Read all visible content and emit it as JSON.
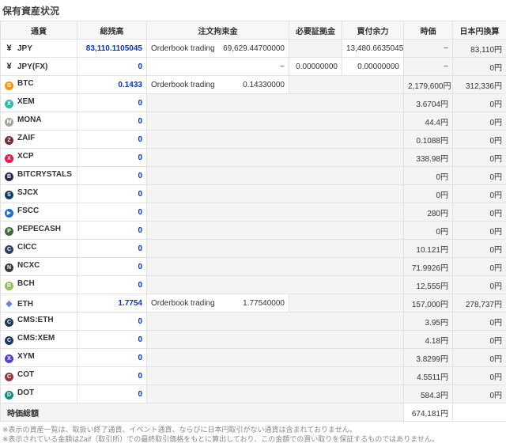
{
  "page": {
    "title": "保有資産状況"
  },
  "colors": {
    "accent_blue": "#0633cc",
    "cell_gray": "#f4f4f4",
    "header_gray": "#f7f7f7"
  },
  "table": {
    "headers": [
      "通貨",
      "総残高",
      "注文拘束金",
      "必要証拠金",
      "買付余力",
      "時価",
      "日本円換算"
    ],
    "rows": [
      {
        "name": "JPY",
        "icon": {
          "name": "jpy-icon",
          "shape": "text",
          "glyph": "¥",
          "color": "#222222"
        },
        "balance": "83,110.1105045",
        "mid": [
          {
            "kind": "orderbook",
            "label": "Orderbook trading",
            "value": "69,629.44700000"
          },
          {
            "kind": "empty"
          },
          {
            "kind": "num",
            "value": "13,480.66350450"
          }
        ],
        "price": "−",
        "jpy": "83,110円"
      },
      {
        "name": "JPY(FX)",
        "icon": {
          "name": "jpyfx-icon",
          "shape": "text",
          "glyph": "¥",
          "color": "#222222"
        },
        "balance": "0",
        "mid": [
          {
            "kind": "num",
            "value": "−"
          },
          {
            "kind": "num",
            "value": "0.00000000"
          },
          {
            "kind": "num",
            "value": "0.00000000"
          }
        ],
        "price": "−",
        "jpy": "0円"
      },
      {
        "name": "BTC",
        "icon": {
          "name": "btc-icon",
          "shape": "circle",
          "glyph": "B",
          "color": "#f7931a"
        },
        "balance": "0.1433",
        "mid": [
          {
            "kind": "orderbook",
            "label": "Orderbook trading",
            "value": "0.14330000"
          },
          {
            "kind": "empty",
            "span": 2
          }
        ],
        "price": "2,179,600円",
        "jpy": "312,336円"
      },
      {
        "name": "XEM",
        "icon": {
          "name": "xem-icon",
          "shape": "circle",
          "glyph": "X",
          "color": "#2dbcab"
        },
        "balance": "0",
        "mid": [
          {
            "kind": "empty",
            "span": 3
          }
        ],
        "price": "3.6704円",
        "jpy": "0円"
      },
      {
        "name": "MONA",
        "icon": {
          "name": "mona-icon",
          "shape": "circle",
          "glyph": "M",
          "color": "#a6a49a"
        },
        "balance": "0",
        "mid": [
          {
            "kind": "empty",
            "span": 3
          }
        ],
        "price": "44.4円",
        "jpy": "0円"
      },
      {
        "name": "ZAIF",
        "icon": {
          "name": "zaif-icon",
          "shape": "circle",
          "glyph": "Z",
          "color": "#7c2d35"
        },
        "balance": "0",
        "mid": [
          {
            "kind": "empty",
            "span": 3
          }
        ],
        "price": "0.1088円",
        "jpy": "0円"
      },
      {
        "name": "XCP",
        "icon": {
          "name": "xcp-icon",
          "shape": "circle",
          "glyph": "X",
          "color": "#ec1550"
        },
        "balance": "0",
        "mid": [
          {
            "kind": "empty",
            "span": 3
          }
        ],
        "price": "338.98円",
        "jpy": "0円"
      },
      {
        "name": "BITCRYSTALS",
        "icon": {
          "name": "bitcrystals-icon",
          "shape": "circle",
          "glyph": "B",
          "color": "#252a52"
        },
        "balance": "0",
        "mid": [
          {
            "kind": "empty",
            "span": 3
          }
        ],
        "price": "0円",
        "jpy": "0円"
      },
      {
        "name": "SJCX",
        "icon": {
          "name": "sjcx-icon",
          "shape": "circle",
          "glyph": "S",
          "color": "#123b66"
        },
        "balance": "0",
        "mid": [
          {
            "kind": "empty",
            "span": 3
          }
        ],
        "price": "0円",
        "jpy": "0円"
      },
      {
        "name": "FSCC",
        "icon": {
          "name": "fscc-icon",
          "shape": "circle",
          "glyph": "▶",
          "color": "#1d6fc2"
        },
        "balance": "0",
        "mid": [
          {
            "kind": "empty",
            "span": 3
          }
        ],
        "price": "280円",
        "jpy": "0円"
      },
      {
        "name": "PEPECASH",
        "icon": {
          "name": "pepecash-icon",
          "shape": "circle",
          "glyph": "P",
          "color": "#3e6b3a"
        },
        "balance": "0",
        "mid": [
          {
            "kind": "empty",
            "span": 3
          }
        ],
        "price": "0円",
        "jpy": "0円"
      },
      {
        "name": "CICC",
        "icon": {
          "name": "cicc-icon",
          "shape": "circle",
          "glyph": "C",
          "color": "#29415f"
        },
        "balance": "0",
        "mid": [
          {
            "kind": "empty",
            "span": 3
          }
        ],
        "price": "10.121円",
        "jpy": "0円"
      },
      {
        "name": "NCXC",
        "icon": {
          "name": "ncxc-icon",
          "shape": "circle",
          "glyph": "N",
          "color": "#3b3b3b"
        },
        "balance": "0",
        "mid": [
          {
            "kind": "empty",
            "span": 3
          }
        ],
        "price": "71.9926円",
        "jpy": "0円"
      },
      {
        "name": "BCH",
        "icon": {
          "name": "bch-icon",
          "shape": "circle",
          "glyph": "B",
          "color": "#8dc351"
        },
        "balance": "0",
        "mid": [
          {
            "kind": "empty",
            "span": 3
          }
        ],
        "price": "12,555円",
        "jpy": "0円"
      },
      {
        "name": "ETH",
        "icon": {
          "name": "eth-icon",
          "shape": "text",
          "glyph": "◆",
          "color": "#6b7fe0"
        },
        "balance": "1.7754",
        "mid": [
          {
            "kind": "orderbook",
            "label": "Orderbook trading",
            "value": "1.77540000"
          },
          {
            "kind": "empty",
            "span": 2
          }
        ],
        "price": "157,000円",
        "jpy": "278,737円"
      },
      {
        "name": "CMS:ETH",
        "icon": {
          "name": "cms-eth-icon",
          "shape": "circle",
          "glyph": "C",
          "color": "#1b3a5c"
        },
        "balance": "0",
        "mid": [
          {
            "kind": "empty",
            "span": 3
          }
        ],
        "price": "3.95円",
        "jpy": "0円"
      },
      {
        "name": "CMS:XEM",
        "icon": {
          "name": "cms-xem-icon",
          "shape": "circle",
          "glyph": "C",
          "color": "#1b3a5c"
        },
        "balance": "0",
        "mid": [
          {
            "kind": "empty",
            "span": 3
          }
        ],
        "price": "4.18円",
        "jpy": "0円"
      },
      {
        "name": "XYM",
        "icon": {
          "name": "xym-icon",
          "shape": "circle",
          "glyph": "X",
          "color": "#5a3fd6"
        },
        "balance": "0",
        "mid": [
          {
            "kind": "empty",
            "span": 3
          }
        ],
        "price": "3.8299円",
        "jpy": "0円"
      },
      {
        "name": "COT",
        "icon": {
          "name": "cot-icon",
          "shape": "circle",
          "glyph": "C",
          "color": "#8d3a43"
        },
        "balance": "0",
        "mid": [
          {
            "kind": "empty",
            "span": 3
          }
        ],
        "price": "4.5511円",
        "jpy": "0円"
      },
      {
        "name": "DOT",
        "icon": {
          "name": "dot-icon",
          "shape": "circle",
          "glyph": "D",
          "color": "#12907f"
        },
        "balance": "0",
        "mid": [
          {
            "kind": "empty",
            "span": 3
          }
        ],
        "price": "584.3円",
        "jpy": "0円"
      }
    ],
    "footer": {
      "label": "時価総額",
      "value": "674,181円"
    }
  },
  "footnotes": [
    "※表示の資産一覧は、取扱い終了通貨、イベント通貨、ならびに日本円取引がない通貨は含まれておりません。",
    "※表示されている金額はZaif（取引所）での最終取引価格をもとに算出しており、この金額での買い取りを保証するものではありません。"
  ]
}
